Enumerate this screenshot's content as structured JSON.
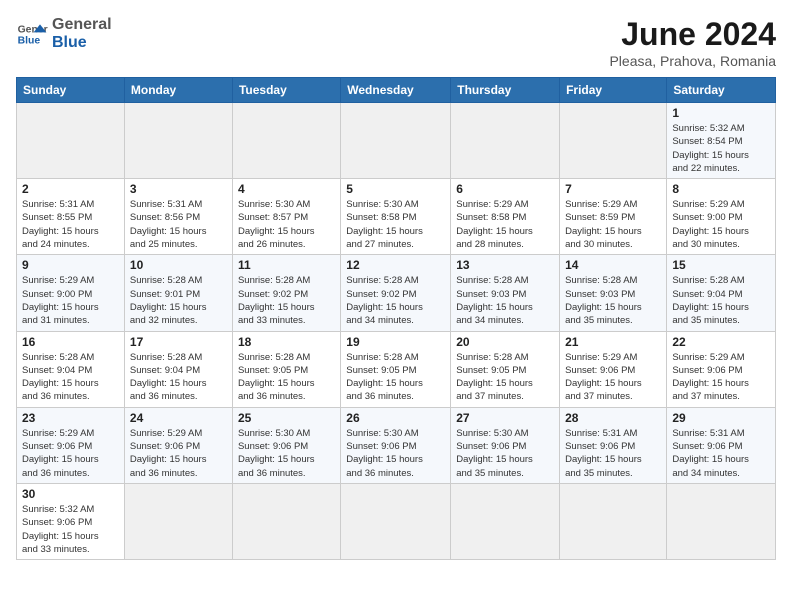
{
  "header": {
    "logo_general": "General",
    "logo_blue": "Blue",
    "title": "June 2024",
    "subtitle": "Pleasa, Prahova, Romania"
  },
  "weekdays": [
    "Sunday",
    "Monday",
    "Tuesday",
    "Wednesday",
    "Thursday",
    "Friday",
    "Saturday"
  ],
  "weeks": [
    [
      {
        "day": "",
        "info": ""
      },
      {
        "day": "",
        "info": ""
      },
      {
        "day": "",
        "info": ""
      },
      {
        "day": "",
        "info": ""
      },
      {
        "day": "",
        "info": ""
      },
      {
        "day": "",
        "info": ""
      },
      {
        "day": "1",
        "info": "Sunrise: 5:32 AM\nSunset: 8:54 PM\nDaylight: 15 hours\nand 22 minutes."
      }
    ],
    [
      {
        "day": "2",
        "info": "Sunrise: 5:31 AM\nSunset: 8:55 PM\nDaylight: 15 hours\nand 24 minutes."
      },
      {
        "day": "3",
        "info": "Sunrise: 5:31 AM\nSunset: 8:56 PM\nDaylight: 15 hours\nand 25 minutes."
      },
      {
        "day": "4",
        "info": "Sunrise: 5:30 AM\nSunset: 8:57 PM\nDaylight: 15 hours\nand 26 minutes."
      },
      {
        "day": "5",
        "info": "Sunrise: 5:30 AM\nSunset: 8:58 PM\nDaylight: 15 hours\nand 27 minutes."
      },
      {
        "day": "6",
        "info": "Sunrise: 5:29 AM\nSunset: 8:58 PM\nDaylight: 15 hours\nand 28 minutes."
      },
      {
        "day": "7",
        "info": "Sunrise: 5:29 AM\nSunset: 8:59 PM\nDaylight: 15 hours\nand 30 minutes."
      },
      {
        "day": "8",
        "info": "Sunrise: 5:29 AM\nSunset: 9:00 PM\nDaylight: 15 hours\nand 30 minutes."
      }
    ],
    [
      {
        "day": "9",
        "info": "Sunrise: 5:29 AM\nSunset: 9:00 PM\nDaylight: 15 hours\nand 31 minutes."
      },
      {
        "day": "10",
        "info": "Sunrise: 5:28 AM\nSunset: 9:01 PM\nDaylight: 15 hours\nand 32 minutes."
      },
      {
        "day": "11",
        "info": "Sunrise: 5:28 AM\nSunset: 9:02 PM\nDaylight: 15 hours\nand 33 minutes."
      },
      {
        "day": "12",
        "info": "Sunrise: 5:28 AM\nSunset: 9:02 PM\nDaylight: 15 hours\nand 34 minutes."
      },
      {
        "day": "13",
        "info": "Sunrise: 5:28 AM\nSunset: 9:03 PM\nDaylight: 15 hours\nand 34 minutes."
      },
      {
        "day": "14",
        "info": "Sunrise: 5:28 AM\nSunset: 9:03 PM\nDaylight: 15 hours\nand 35 minutes."
      },
      {
        "day": "15",
        "info": "Sunrise: 5:28 AM\nSunset: 9:04 PM\nDaylight: 15 hours\nand 35 minutes."
      }
    ],
    [
      {
        "day": "16",
        "info": "Sunrise: 5:28 AM\nSunset: 9:04 PM\nDaylight: 15 hours\nand 36 minutes."
      },
      {
        "day": "17",
        "info": "Sunrise: 5:28 AM\nSunset: 9:04 PM\nDaylight: 15 hours\nand 36 minutes."
      },
      {
        "day": "18",
        "info": "Sunrise: 5:28 AM\nSunset: 9:05 PM\nDaylight: 15 hours\nand 36 minutes."
      },
      {
        "day": "19",
        "info": "Sunrise: 5:28 AM\nSunset: 9:05 PM\nDaylight: 15 hours\nand 36 minutes."
      },
      {
        "day": "20",
        "info": "Sunrise: 5:28 AM\nSunset: 9:05 PM\nDaylight: 15 hours\nand 37 minutes."
      },
      {
        "day": "21",
        "info": "Sunrise: 5:29 AM\nSunset: 9:06 PM\nDaylight: 15 hours\nand 37 minutes."
      },
      {
        "day": "22",
        "info": "Sunrise: 5:29 AM\nSunset: 9:06 PM\nDaylight: 15 hours\nand 37 minutes."
      }
    ],
    [
      {
        "day": "23",
        "info": "Sunrise: 5:29 AM\nSunset: 9:06 PM\nDaylight: 15 hours\nand 36 minutes."
      },
      {
        "day": "24",
        "info": "Sunrise: 5:29 AM\nSunset: 9:06 PM\nDaylight: 15 hours\nand 36 minutes."
      },
      {
        "day": "25",
        "info": "Sunrise: 5:30 AM\nSunset: 9:06 PM\nDaylight: 15 hours\nand 36 minutes."
      },
      {
        "day": "26",
        "info": "Sunrise: 5:30 AM\nSunset: 9:06 PM\nDaylight: 15 hours\nand 36 minutes."
      },
      {
        "day": "27",
        "info": "Sunrise: 5:30 AM\nSunset: 9:06 PM\nDaylight: 15 hours\nand 35 minutes."
      },
      {
        "day": "28",
        "info": "Sunrise: 5:31 AM\nSunset: 9:06 PM\nDaylight: 15 hours\nand 35 minutes."
      },
      {
        "day": "29",
        "info": "Sunrise: 5:31 AM\nSunset: 9:06 PM\nDaylight: 15 hours\nand 34 minutes."
      }
    ],
    [
      {
        "day": "30",
        "info": "Sunrise: 5:32 AM\nSunset: 9:06 PM\nDaylight: 15 hours\nand 33 minutes."
      },
      {
        "day": "",
        "info": ""
      },
      {
        "day": "",
        "info": ""
      },
      {
        "day": "",
        "info": ""
      },
      {
        "day": "",
        "info": ""
      },
      {
        "day": "",
        "info": ""
      },
      {
        "day": "",
        "info": ""
      }
    ]
  ]
}
